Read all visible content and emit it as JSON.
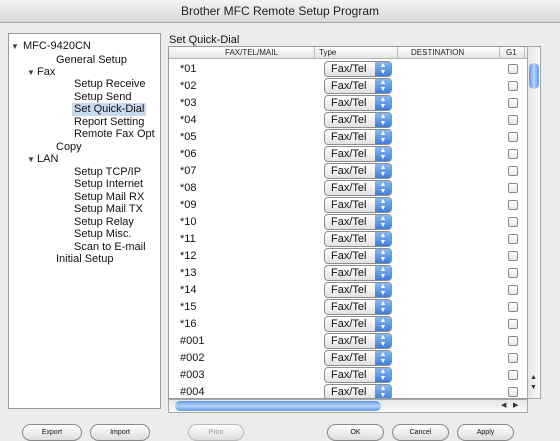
{
  "window": {
    "title": "Brother MFC Remote Setup Program"
  },
  "tree": {
    "items": [
      {
        "label": "MFC-9420CN",
        "expanded": true,
        "selected": false
      },
      {
        "label": "General Setup",
        "selected": false
      },
      {
        "label": "Fax",
        "expanded": true,
        "selected": false
      },
      {
        "label": "Setup Receive",
        "selected": false
      },
      {
        "label": "Setup Send",
        "selected": false
      },
      {
        "label": "Set Quick-Dial",
        "selected": true
      },
      {
        "label": "Report Setting",
        "selected": false
      },
      {
        "label": "Remote Fax Opt",
        "selected": false
      },
      {
        "label": "Copy",
        "selected": false
      },
      {
        "label": "LAN",
        "expanded": true,
        "selected": false
      },
      {
        "label": "Setup TCP/IP",
        "selected": false
      },
      {
        "label": "Setup Internet",
        "selected": false
      },
      {
        "label": "Setup Mail RX",
        "selected": false
      },
      {
        "label": "Setup Mail TX",
        "selected": false
      },
      {
        "label": "Setup Relay",
        "selected": false
      },
      {
        "label": "Setup Misc.",
        "selected": false
      },
      {
        "label": "Scan to E-mail",
        "selected": false
      },
      {
        "label": "Initial Setup",
        "selected": false
      }
    ]
  },
  "table": {
    "title": "Set Quick-Dial",
    "columns": [
      "FAX/TEL/MAIL",
      "Type",
      "DESTINATION",
      "G1"
    ],
    "rows": [
      {
        "code": "*01",
        "type": "Fax/Tel"
      },
      {
        "code": "*02",
        "type": "Fax/Tel"
      },
      {
        "code": "*03",
        "type": "Fax/Tel"
      },
      {
        "code": "*04",
        "type": "Fax/Tel"
      },
      {
        "code": "*05",
        "type": "Fax/Tel"
      },
      {
        "code": "*06",
        "type": "Fax/Tel"
      },
      {
        "code": "*07",
        "type": "Fax/Tel"
      },
      {
        "code": "*08",
        "type": "Fax/Tel"
      },
      {
        "code": "*09",
        "type": "Fax/Tel"
      },
      {
        "code": "*10",
        "type": "Fax/Tel"
      },
      {
        "code": "*11",
        "type": "Fax/Tel"
      },
      {
        "code": "*12",
        "type": "Fax/Tel"
      },
      {
        "code": "*13",
        "type": "Fax/Tel"
      },
      {
        "code": "*14",
        "type": "Fax/Tel"
      },
      {
        "code": "*15",
        "type": "Fax/Tel"
      },
      {
        "code": "*16",
        "type": "Fax/Tel"
      },
      {
        "code": "#001",
        "type": "Fax/Tel"
      },
      {
        "code": "#002",
        "type": "Fax/Tel"
      },
      {
        "code": "#003",
        "type": "Fax/Tel"
      },
      {
        "code": "#004",
        "type": "Fax/Tel"
      }
    ]
  },
  "buttons": {
    "export": "Export",
    "import": "Import",
    "print": "Print",
    "ok": "OK",
    "cancel": "Cancel",
    "apply": "Apply"
  }
}
